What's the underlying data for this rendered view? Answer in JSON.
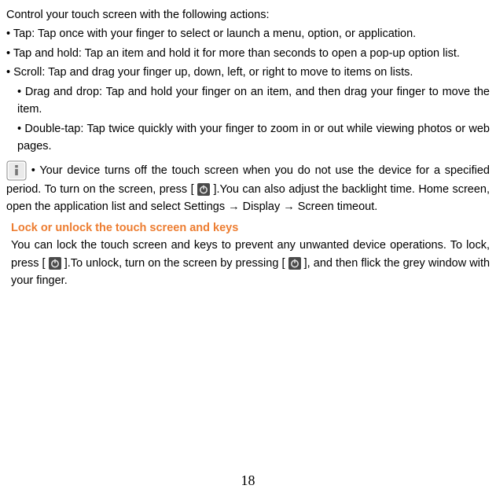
{
  "intro": "Control your touch screen with the following actions:",
  "bullets": {
    "tap": "• Tap: Tap once with your finger to select or launch a menu, option, or application.",
    "taphold": "• Tap and hold: Tap an item and hold it for more than seconds to open a pop-up option list.",
    "scroll": "• Scroll: Tap and drag your finger up, down, left, or right to move to items on lists.",
    "dragdrop": "• Drag and drop: Tap and hold your finger on an item, and then drag your finger to move the item.",
    "doubletap": "• Double-tap: Tap twice quickly with your finger to zoom in or out while viewing photos or web pages."
  },
  "screen_off": {
    "leadin": " • Your device turns off the touch screen when you do not use the device for a specified period. To turn on the screen, press [",
    "mid": "].You can also adjust the backlight time. Home screen, open the application list and select Settings → Display → Screen timeout."
  },
  "lock": {
    "heading": "Lock or unlock the touch screen and keys",
    "p1": "You can lock the touch screen and keys to prevent any unwanted device operations. To lock, press [",
    "p2": "].To unlock, turn on the screen by pressing [",
    "p3": "], and then flick the grey window with your finger."
  },
  "page_number": "18"
}
